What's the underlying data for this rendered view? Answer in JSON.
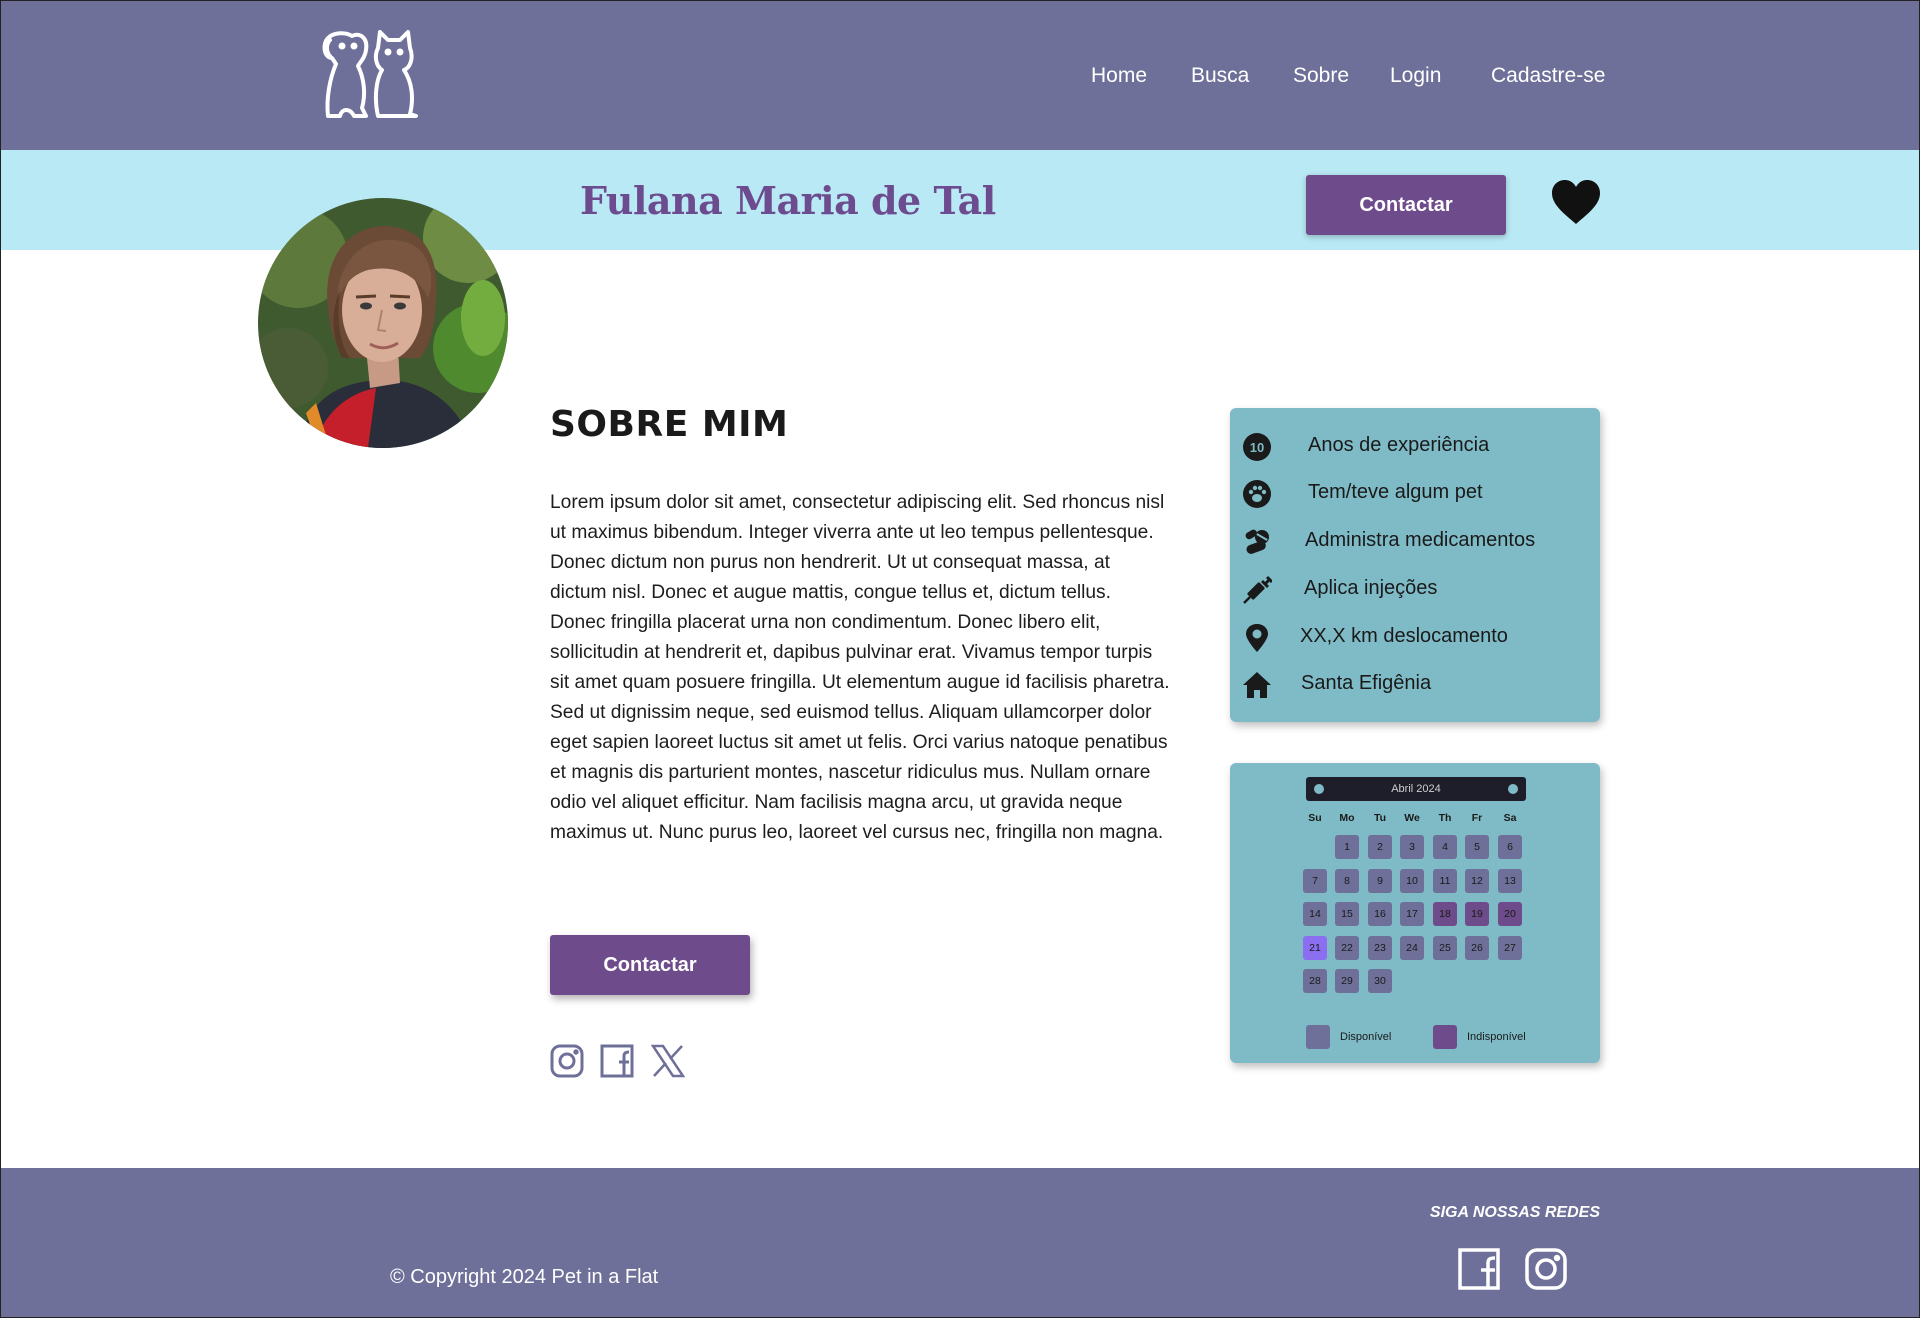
{
  "header": {
    "logo_alt": "Pet in a Flat",
    "nav": [
      "Home",
      "Busca",
      "Sobre",
      "Login",
      "Cadastre-se"
    ]
  },
  "profile": {
    "name": "Fulana Maria de Tal",
    "contact_label": "Contactar",
    "favorite_icon": "heart-icon"
  },
  "about": {
    "title": "SOBRE MIM",
    "text": "Lorem ipsum dolor sit amet, consectetur adipiscing elit. Sed rhoncus nisl ut maximus bibendum. Integer viverra ante ut leo tempus pellentesque. Donec dictum non purus non hendrerit. Ut ut consequat massa, at dictum nisl. Donec et augue mattis, congue tellus et, dictum tellus. Donec fringilla placerat urna non condimentum. Donec libero elit, sollicitudin at hendrerit et, dapibus pulvinar erat. Vivamus tempor turpis sit amet quam posuere fringilla. Ut elementum augue id facilisis pharetra. Sed ut dignissim neque, sed euismod tellus. Aliquam ullamcorper dolor eget sapien laoreet luctus sit amet ut felis. Orci varius natoque penatibus et magnis dis parturient montes, nascetur ridiculus mus. Nullam ornare odio vel aliquet efficitur. Nam facilisis magna arcu, ut gravida neque maximus ut. Nunc purus leo, laoreet vel cursus nec, fringilla non magna.",
    "contact_label": "Contactar",
    "socials": [
      "instagram-icon",
      "facebook-icon",
      "x-icon"
    ]
  },
  "info": {
    "items": [
      {
        "icon": "experience-10-icon",
        "badge": "10",
        "label": "Anos de experiência"
      },
      {
        "icon": "paw-icon",
        "label": "Tem/teve algum pet"
      },
      {
        "icon": "pills-icon",
        "label": "Administra medicamentos"
      },
      {
        "icon": "syringe-icon",
        "label": "Aplica injeções"
      },
      {
        "icon": "location-pin-icon",
        "label": "XX,X km deslocamento"
      },
      {
        "icon": "home-icon",
        "label": "Santa Efigênia"
      }
    ]
  },
  "calendar": {
    "month": "Abril 2024",
    "weekdays": [
      "Su",
      "Mo",
      "Tu",
      "We",
      "Th",
      "Fr",
      "Sa"
    ],
    "days": [
      "1",
      "2",
      "3",
      "4",
      "5",
      "6",
      "7",
      "8",
      "9",
      "10",
      "11",
      "12",
      "13",
      "14",
      "15",
      "16",
      "17",
      "18",
      "19",
      "20",
      "21",
      "22",
      "23",
      "24",
      "25",
      "26",
      "27",
      "28",
      "29",
      "30"
    ],
    "first_weekday_index": 1,
    "unavailable_days": [
      18,
      19,
      20
    ],
    "selected_day": 21,
    "legend": {
      "available": "Disponível",
      "unavailable": "Indisponível"
    },
    "colors": {
      "available": "#6e7099",
      "unavailable": "#6e4c8c",
      "selected": "#8c6ef0"
    }
  },
  "footer": {
    "copyright": "© Copyright 2024 Pet in a Flat",
    "follow_title": "SIGA NOSSAS REDES",
    "socials": [
      "facebook-icon",
      "instagram-icon"
    ]
  },
  "colors": {
    "header_bg": "#6e7099",
    "banner_bg": "#b8e9f4",
    "accent_purple": "#6e4c8c",
    "card_bg": "#7fbbc7"
  }
}
